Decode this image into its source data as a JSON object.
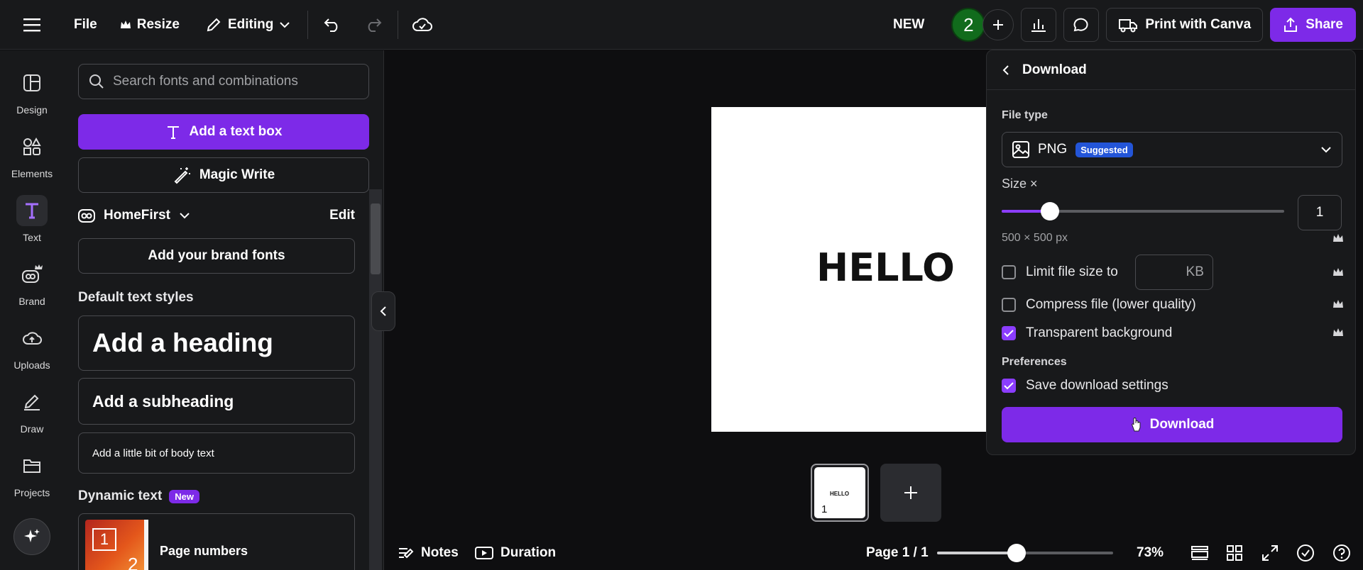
{
  "topbar": {
    "file": "File",
    "resize": "Resize",
    "editing": "Editing",
    "new_label": "NEW",
    "avatar_letter": "2",
    "print": "Print with Canva",
    "share": "Share"
  },
  "rail": {
    "items": [
      {
        "label": "Design",
        "icon": "design-icon"
      },
      {
        "label": "Elements",
        "icon": "elements-icon"
      },
      {
        "label": "Text",
        "icon": "text-icon"
      },
      {
        "label": "Brand",
        "icon": "brand-icon"
      },
      {
        "label": "Uploads",
        "icon": "uploads-icon"
      },
      {
        "label": "Draw",
        "icon": "draw-icon"
      },
      {
        "label": "Projects",
        "icon": "projects-icon"
      }
    ],
    "active": "Text"
  },
  "panel": {
    "search_placeholder": "Search fonts and combinations",
    "add_text_box": "Add a text box",
    "magic_write": "Magic Write",
    "brand_kit": "HomeFirst",
    "edit": "Edit",
    "add_brand_fonts": "Add your brand fonts",
    "default_styles_title": "Default text styles",
    "heading": "Add a heading",
    "subheading": "Add a subheading",
    "body": "Add a little bit of body text",
    "dynamic_title": "Dynamic text",
    "new_badge": "New",
    "page_numbers": "Page numbers",
    "page_numbers_thumb_a": "1",
    "page_numbers_thumb_b": "2"
  },
  "canvas": {
    "text": "HELLO",
    "thumb_text": "HELLO",
    "thumb_page": "1"
  },
  "bottombar": {
    "notes": "Notes",
    "duration": "Duration",
    "page_indicator": "Page 1 / 1",
    "zoom": "73%",
    "zoom_fraction": 0.45
  },
  "download": {
    "title": "Download",
    "file_type_label": "File type",
    "file_type": "PNG",
    "suggested": "Suggested",
    "size_label": "Size ×",
    "size_value": "1",
    "size_fraction": 0.17,
    "dimensions": "500 × 500 px",
    "limit_label": "Limit file size to",
    "kb_unit": "KB",
    "compress_label": "Compress file (lower quality)",
    "transparent_label": "Transparent background",
    "preferences_label": "Preferences",
    "save_settings_label": "Save download settings",
    "download_button": "Download"
  },
  "colors": {
    "accent": "#7d2ae8",
    "suggested_badge": "#2355d8",
    "avatar": "#116b1c"
  }
}
